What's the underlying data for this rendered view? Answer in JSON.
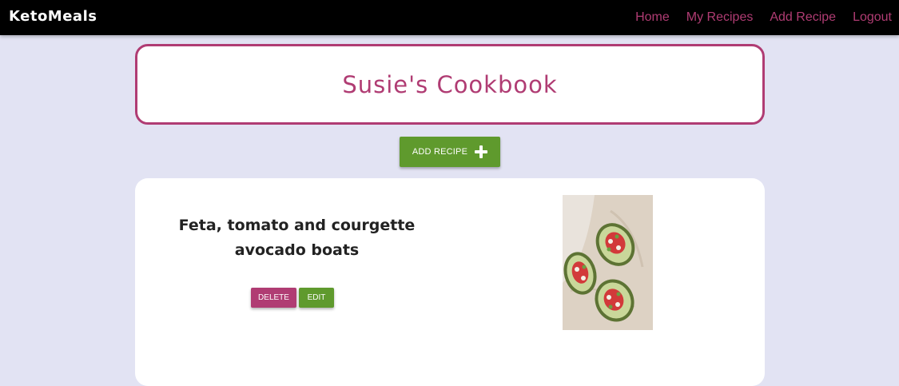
{
  "navbar": {
    "brand": "KetoMeals",
    "links": [
      "Home",
      "My Recipes",
      "Add Recipe",
      "Logout"
    ],
    "link_color": "#b03c73",
    "background": "#000000"
  },
  "page": {
    "title": "Susie's Cookbook",
    "add_button_label": "ADD RECIPE",
    "add_button_icon": "plus-icon"
  },
  "recipes": [
    {
      "title": "Feta, tomato and courgette avocado boats",
      "delete_label": "DELETE",
      "edit_label": "EDIT",
      "image": "avocado-boats-photo"
    }
  ],
  "colors": {
    "accent": "#b03c73",
    "green": "#5f9a2d",
    "page_background": "#e2e3f3"
  }
}
